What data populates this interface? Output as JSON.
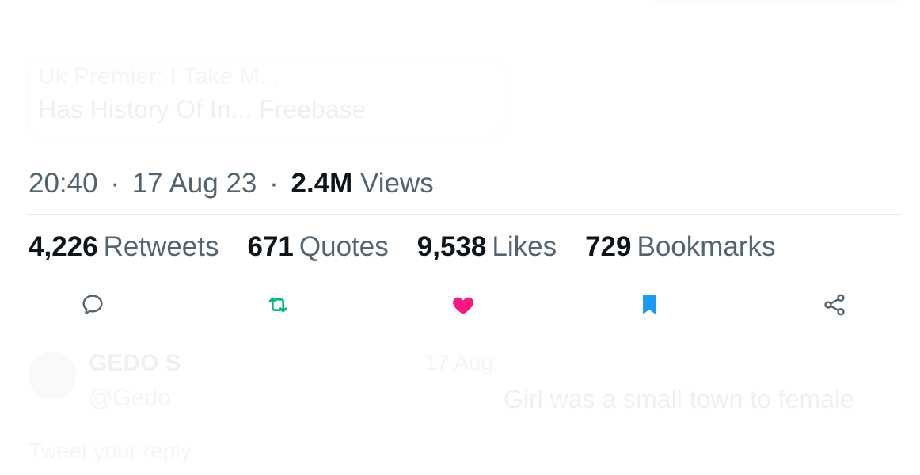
{
  "ghost": {
    "line1": "Uk Premier: I Take M...",
    "line2": "Has History Of In... Freebase",
    "reply_name": "GEDO S",
    "reply_handle": "@Gedo",
    "reply_mid": "17 Aug",
    "reply_text": "Girl was a small town to female",
    "reply_bottom": "Tweet your reply"
  },
  "tweet_meta": {
    "time": "20:40",
    "separator": "·",
    "date": "17 Aug 23",
    "views_count": "2.4M",
    "views_label": "Views"
  },
  "stats": [
    {
      "count": "4,226",
      "label": "Retweets"
    },
    {
      "count": "671",
      "label": "Quotes"
    },
    {
      "count": "9,538",
      "label": "Likes"
    },
    {
      "count": "729",
      "label": "Bookmarks"
    }
  ],
  "actions": [
    {
      "name": "reply-icon",
      "color": "#536471"
    },
    {
      "name": "retweet-icon",
      "color": "#00ba7c",
      "state": "active"
    },
    {
      "name": "like-icon",
      "color": "#f91880",
      "state": "active"
    },
    {
      "name": "bookmark-icon",
      "color": "#1d9bf0",
      "state": "active"
    },
    {
      "name": "share-icon",
      "color": "#536471"
    }
  ]
}
